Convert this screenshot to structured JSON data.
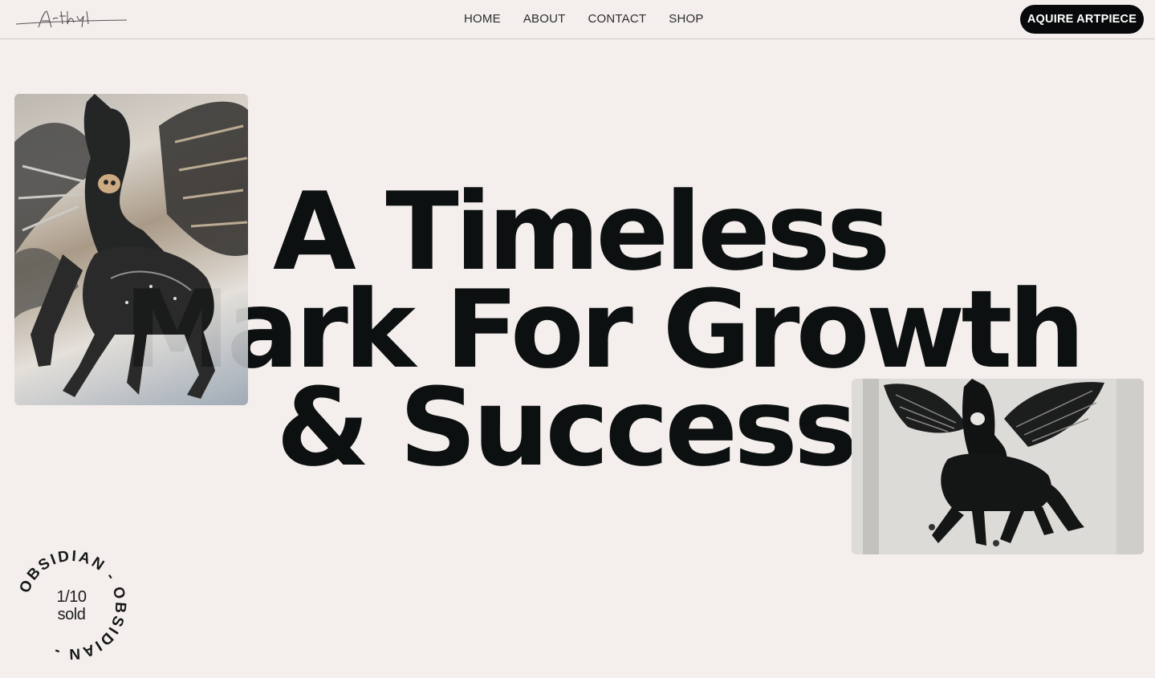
{
  "header": {
    "logo_text": "Arthyl",
    "nav": [
      "HOME",
      "ABOUT",
      "CONTACT",
      "SHOP"
    ],
    "cta_label": "AQUIRE ARTPIECE"
  },
  "hero": {
    "line1": "A Timeless",
    "line2": "Mark For Growth",
    "line3": "& Success."
  },
  "images": {
    "primary_alt": "winged black horse sculpture close-up",
    "secondary_alt": "winged black horse sculpture on white wall"
  },
  "badge": {
    "ring_text": "OBSIDIAN  -  OBSIDIAN  -  ",
    "count": "1/10",
    "sold": "sold"
  }
}
